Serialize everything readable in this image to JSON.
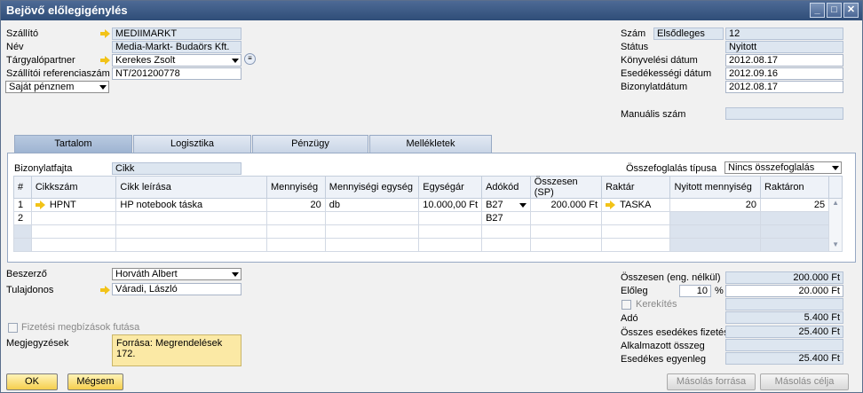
{
  "window": {
    "title": "Bejövő előlegigénylés"
  },
  "header_left": {
    "supplier_label": "Szállító",
    "supplier_value": "MEDIIMARKT",
    "name_label": "Név",
    "name_value": "Media-Markt- Budaörs Kft.",
    "contact_label": "Tárgyalópartner",
    "contact_value": "Kerekes Zsolt",
    "ref_label": "Szállítói referenciaszám",
    "ref_value": "NT/201200778",
    "currency_value": "Saját pénznem"
  },
  "header_right": {
    "number_label": "Szám",
    "number_series": "Elsődleges",
    "number_value": "12",
    "status_label": "Státus",
    "status_value": "Nyitott",
    "posting_label": "Könyvelési dátum",
    "posting_value": "2012.08.17",
    "due_label": "Esedékességi dátum",
    "due_value": "2012.09.16",
    "doc_date_label": "Bizonylatdátum",
    "doc_date_value": "2012.08.17",
    "manual_label": "Manuális szám"
  },
  "tabs": [
    "Tartalom",
    "Logisztika",
    "Pénzügy",
    "Mellékletek"
  ],
  "content": {
    "doc_type_label": "Bizonylatfajta",
    "doc_type_value": "Cikk",
    "summary_label": "Összefoglalás típusa",
    "summary_value": "Nincs összefoglalás"
  },
  "table": {
    "columns": [
      "#",
      "Cikkszám",
      "Cikk leírása",
      "Mennyiség",
      "Mennyiségi egység",
      "Egységár",
      "Adókód",
      "Összesen (SP)",
      "Raktár",
      "Nyitott mennyiség",
      "Raktáron"
    ],
    "row1": {
      "n": "1",
      "item": "HPNT",
      "desc": "HP notebook táska",
      "qty": "20",
      "unit": "db",
      "price": "10.000,00 Ft",
      "tax": "B27",
      "total": "200.000 Ft",
      "wh": "TASKA",
      "open": "20",
      "stock": "25"
    },
    "row2": {
      "n": "2",
      "tax": "B27"
    }
  },
  "footer_left": {
    "buyer_label": "Beszerző",
    "buyer_value": "Horváth Albert",
    "owner_label": "Tulajdonos",
    "owner_value": "Váradi, László",
    "payment_run_label": "Fizetési megbízások futása",
    "remarks_label": "Megjegyzések",
    "remarks_value": "Forrása: Megrendelések 172."
  },
  "totals": {
    "net_label": "Összesen (eng. nélkül)",
    "net_value": "200.000 Ft",
    "dp_label": "Előleg",
    "dp_pct": "10",
    "pct_sign": "%",
    "dp_value": "20.000 Ft",
    "rounding_label": "Kerekítés",
    "tax_label": "Adó",
    "tax_value": "5.400 Ft",
    "total_due_label": "Összes esedékes fizetés",
    "total_due_value": "25.400 Ft",
    "applied_label": "Alkalmazott összeg",
    "balance_label": "Esedékes egyenleg",
    "balance_value": "25.400 Ft"
  },
  "buttons": {
    "ok": "OK",
    "cancel": "Mégsem",
    "copy_from": "Másolás forrása",
    "copy_to": "Másolás célja"
  }
}
